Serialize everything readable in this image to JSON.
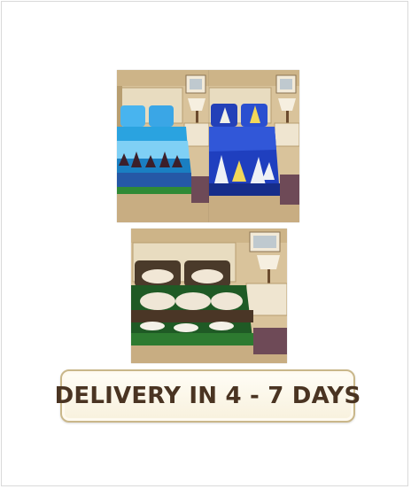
{
  "banner": {
    "text": "DELIVERY IN 4 - 7 DAYS"
  },
  "products": [
    {
      "name": "blue-sky-print-bedsheet"
    },
    {
      "name": "blue-ship-print-bedsheet"
    },
    {
      "name": "green-3d-print-bedsheet"
    }
  ],
  "colors": {
    "banner_border": "#c9b78a",
    "banner_text": "#4a3422",
    "wall": "#d8c29a",
    "sheet_blue": "#2aa3e0",
    "sheet_royal": "#1f3fbf",
    "sheet_green": "#1f5a25"
  }
}
